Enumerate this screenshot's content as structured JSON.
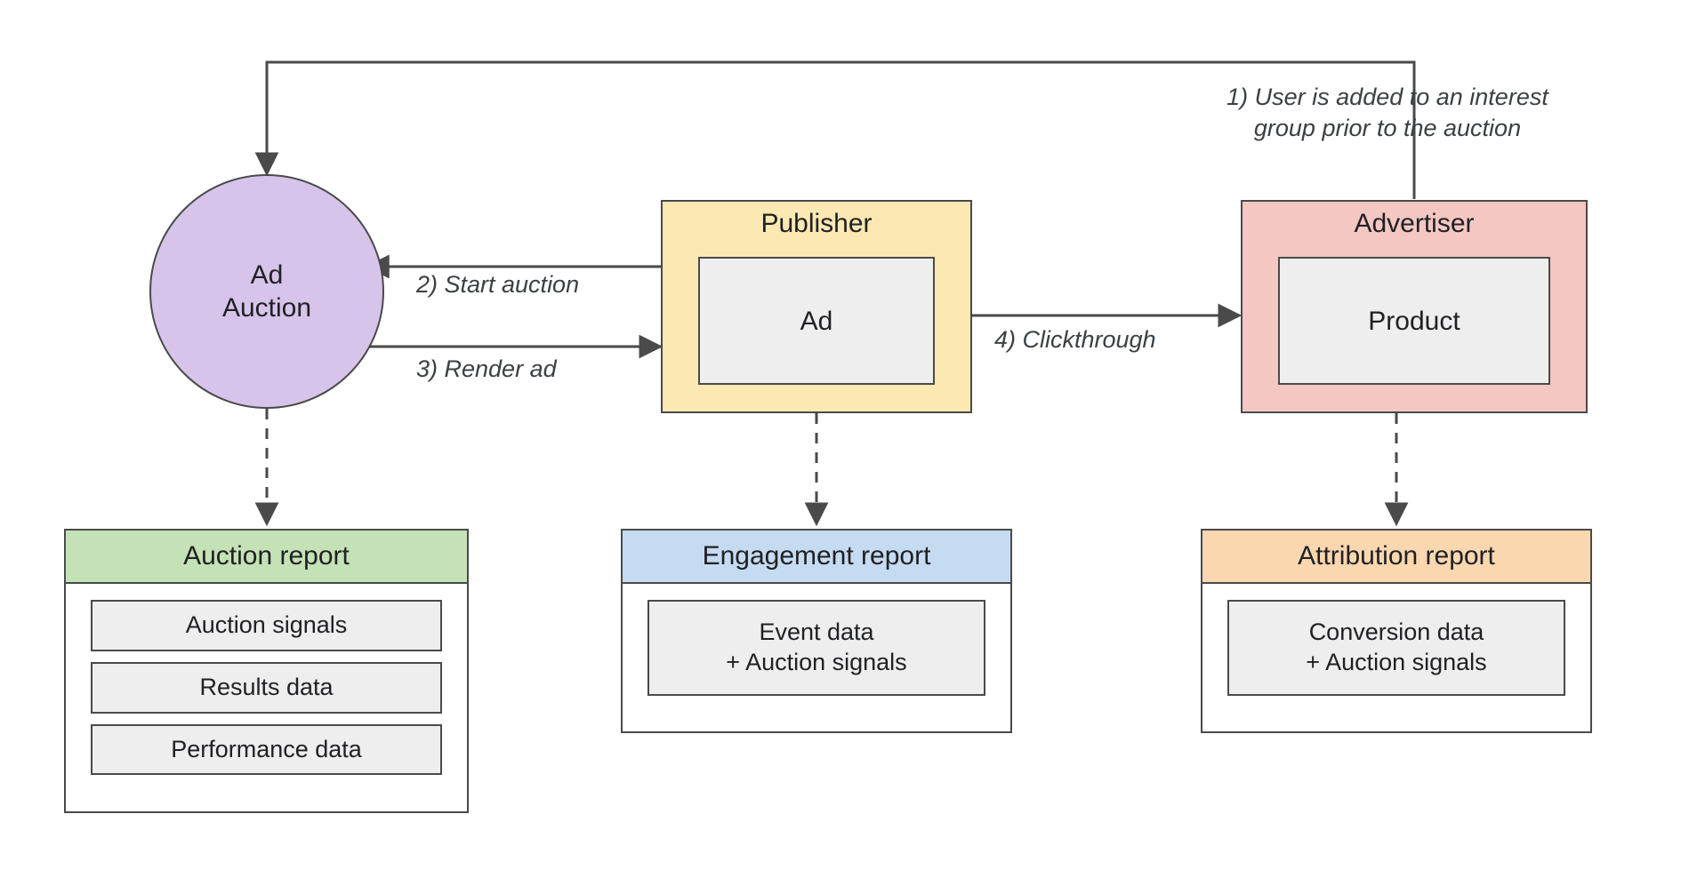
{
  "nodes": {
    "ad_auction": {
      "label": "Ad\nAuction",
      "fill": "#d7c4ea"
    },
    "publisher": {
      "label": "Publisher",
      "inner": "Ad",
      "fill": "#fce8b2"
    },
    "advertiser": {
      "label": "Advertiser",
      "inner": "Product",
      "fill": "#f4c7c3"
    }
  },
  "reports": {
    "auction": {
      "title": "Auction report",
      "header_fill": "#c4e2b5",
      "items": [
        "Auction signals",
        "Results data",
        "Performance data"
      ]
    },
    "engagement": {
      "title": "Engagement report",
      "header_fill": "#c5dbf2",
      "items": [
        "Event data\n+ Auction signals"
      ]
    },
    "attribution": {
      "title": "Attribution report",
      "header_fill": "#fbd7b0",
      "items": [
        "Conversion data\n+ Auction signals"
      ]
    }
  },
  "edges": {
    "step1": "1) User is added to an interest\ngroup prior to the auction",
    "step2": "2) Start auction",
    "step3": "3) Render ad",
    "step4": "4) Clickthrough"
  },
  "colors": {
    "stroke": "#4a4a4a"
  }
}
